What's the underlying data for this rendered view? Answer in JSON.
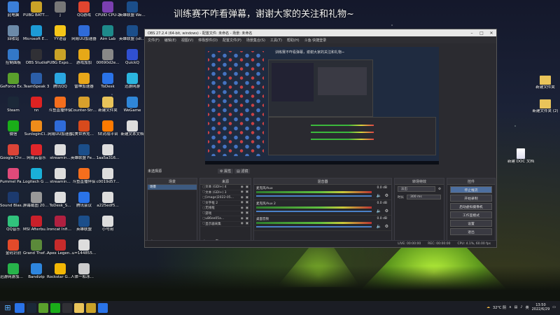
{
  "banner": "训练赛不咋看弹幕，谢谢大家的关注和礼物~",
  "desktop_left": [
    {
      "label": "此电脑",
      "color": "#3b7fd9"
    },
    {
      "label": "PUBG BATTLEGR...",
      "color": "#c9a227"
    },
    {
      "label": "j",
      "color": "#777"
    },
    {
      "label": "QQ游戏",
      "color": "#e0452f"
    },
    {
      "label": "CPUID CPU-Z",
      "color": "#7a3fb0"
    },
    {
      "label": "英雄联盟 WeGame版",
      "color": "#1b4e8a"
    },
    {
      "label": "回收站",
      "color": "#6c8aa8"
    },
    {
      "label": "Microsoft Edge",
      "color": "#1d9bd6"
    },
    {
      "label": "YY语音",
      "color": "#f5c518"
    },
    {
      "label": "网易UU加速器",
      "color": "#2f6bd8"
    },
    {
      "label": "Aim Lab",
      "color": "#1e8a8a"
    },
    {
      "label": "英雄联盟 (slipped)...",
      "color": "#1b4e8a"
    },
    {
      "label": "控制面板",
      "color": "#3378c8"
    },
    {
      "label": "OBS Studio",
      "color": "#303035"
    },
    {
      "label": "PUBG Export...",
      "color": "#c9a227"
    },
    {
      "label": "游戏加加",
      "color": "#e6a817"
    },
    {
      "label": "00690d2e...",
      "color": "#888"
    },
    {
      "label": "QuickQ",
      "color": "#3050d0"
    },
    {
      "label": "GeForce Experience",
      "color": "#5aa02c"
    },
    {
      "label": "TeamSpeak 3",
      "color": "#2b5ea8"
    },
    {
      "label": "腾讯QQ",
      "color": "#2aa6e0"
    },
    {
      "label": "雷神加速器",
      "color": "#e8a71a"
    },
    {
      "label": "ToDesk",
      "color": "#2a73e8"
    },
    {
      "label": "迅游网游",
      "color": "#2bb5e0"
    },
    {
      "label": "Steam",
      "color": "#1b2838"
    },
    {
      "label": "nn",
      "color": "#d22"
    },
    {
      "label": "斗鱼直播伴侣",
      "color": "#f56e1d"
    },
    {
      "label": "Counter-Strike Global Of...",
      "color": "#d8a02c"
    },
    {
      "label": "新建文件夹",
      "color": "#e9c45a"
    },
    {
      "label": "WeGame",
      "color": "#2f86d8"
    },
    {
      "label": "微信",
      "color": "#1aad19"
    },
    {
      "label": "SunloginCl...",
      "color": "#f08c1a"
    },
    {
      "label": "网易UU加速器",
      "color": "#2f6bd8"
    },
    {
      "label": "完美世界竞技平台",
      "color": "#d84a1c"
    },
    {
      "label": "5E对战平台",
      "color": "#ff7a00"
    },
    {
      "label": "新建文本文档",
      "color": "#ddd"
    },
    {
      "label": "Google Chrome",
      "color": "#db4437"
    },
    {
      "label": "网易云音乐",
      "color": "#e0262a"
    },
    {
      "label": "streamin...",
      "color": "#ddd"
    },
    {
      "label": "英雄联盟 Fear sur...",
      "color": "#1b4e8a"
    },
    {
      "label": "1aa5a316...",
      "color": "#ddd"
    },
    {
      "label": "Pummel Party",
      "color": "#e04a7a"
    },
    {
      "label": "Logitech G HUB",
      "color": "#1ab0d8"
    },
    {
      "label": "streamin...",
      "color": "#ddd"
    },
    {
      "label": "斗鱼直播伴侣",
      "color": "#f56e1d"
    },
    {
      "label": "c0019d57...",
      "color": "#ddd"
    },
    {
      "label": "Sound Blaster ...",
      "color": "#1c3a6e"
    },
    {
      "label": "屏幕截图 2022-05-...",
      "color": "#999"
    },
    {
      "label": "ToDesk_S...",
      "color": "#ddd"
    },
    {
      "label": "腾讯会议",
      "color": "#2a73e8"
    },
    {
      "label": "a225edf5...",
      "color": "#ddd"
    },
    {
      "label": "QQ音乐",
      "color": "#31c27c"
    },
    {
      "label": "MSI Afterburner",
      "color": "#c9202a"
    },
    {
      "label": "Ironcat Infinity...",
      "color": "#b02040"
    },
    {
      "label": "英雄联盟",
      "color": "#1b4e8a"
    },
    {
      "label": "小号用",
      "color": "#ddd"
    },
    {
      "label": "金码识别",
      "color": "#e24a2a"
    },
    {
      "label": "Grand Theft Auto V",
      "color": "#5b8a3a"
    },
    {
      "label": "Apex Legends",
      "color": "#c72b2b"
    },
    {
      "label": "u=144855...",
      "color": "#ddd"
    },
    {
      "label": "迅游网游加速器",
      "color": "#27b34a"
    },
    {
      "label": "Bandizip",
      "color": "#2e86de"
    },
    {
      "label": "Rockstar Games...",
      "color": "#f2b705"
    },
    {
      "label": "人体一和冰的 Hum...",
      "color": "#ccc"
    }
  ],
  "desktop_right": [
    {
      "label": "新建文件夹"
    },
    {
      "label": "新建文件夹 (2)"
    },
    {
      "label": "新建 DOC 文档"
    }
  ],
  "obs": {
    "title": "OBS 27.2.4 (64-bit, windows) - 配置文件: 未命名 - 场景: 未命名",
    "menu": [
      "文件(F)",
      "编辑(E)",
      "视图(V)",
      "停靠部件(D)",
      "配置文件(P)",
      "场景集合(S)",
      "工具(T)",
      "帮助(H)",
      "斗鱼·快捷登录"
    ],
    "preview_banner": "训练赛不咋看弹幕，谢谢大家的关注和礼物~",
    "scene_label": "未选择源",
    "props_btn": "属性",
    "filter_btn": "滤镜",
    "docks": {
      "scenes": "场景",
      "sources": "来源",
      "mixer": "混音器",
      "transitions": "转场特效",
      "controls": "控件"
    },
    "scenes": [
      "场景"
    ],
    "sources": [
      "文本 (GDI+) 4",
      "文本 (GDI+) 3",
      "[image]2022-05...",
      "文字框 2",
      "无线框",
      "游戏",
      "u86ee05a...",
      "显示器采集"
    ],
    "mixer": [
      {
        "name": "麦克风/Aux",
        "value": "0.0 dB"
      },
      {
        "name": "麦克风/Aux 2",
        "value": "0.0 dB"
      },
      {
        "name": "桌面音频",
        "value": "0.0 dB"
      }
    ],
    "transition": {
      "type": "淡出",
      "duration_label": "时长",
      "duration": "300 ms"
    },
    "controls": [
      "停止推流",
      "开始录制",
      "启动虚拟摄像机",
      "工作室模式",
      "设置",
      "退出"
    ],
    "status": {
      "live": "LIVE: 00:00:00",
      "rec": "REC: 00:00:00",
      "cpu": "CPU: 4.1%, 60.00 fps"
    }
  },
  "taskbar": {
    "weather": "32°C 阴",
    "lang": "英",
    "time": "13:50",
    "date": "2022/6/29"
  }
}
